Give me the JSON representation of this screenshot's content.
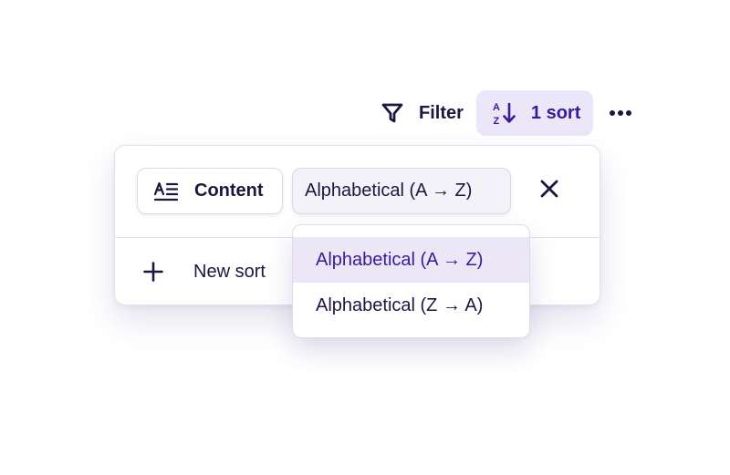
{
  "toolbar": {
    "filter_label": "Filter",
    "filter_icon": "filter-funnel-icon",
    "sort_label": "1 sort",
    "sort_icon": "sort-az-icon",
    "more_icon": "more-horizontal-icon"
  },
  "sort_panel": {
    "field_chip": {
      "label": "Content",
      "icon": "text-field-icon"
    },
    "order_chip": {
      "label": "Alphabetical (A → Z)"
    },
    "remove_icon": "close-icon",
    "new_sort": {
      "label": "New sort",
      "icon": "plus-icon"
    }
  },
  "order_dropdown": {
    "options": [
      {
        "label": "Alphabetical (A → Z)",
        "selected": true
      },
      {
        "label": "Alphabetical (Z → A)",
        "selected": false
      }
    ]
  },
  "colors": {
    "accent": "#3a1a9b",
    "accent_bg": "#ebe7f8",
    "text": "#1d1640",
    "border": "#dcd9e6"
  }
}
